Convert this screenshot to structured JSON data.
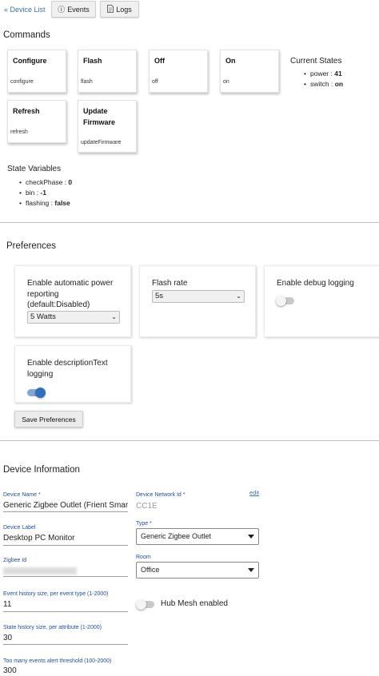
{
  "nav": {
    "back": "« Device List",
    "events": "Events",
    "logs": "Logs",
    "events_icon": "info-circle-icon",
    "logs_icon": "document-icon"
  },
  "commands": {
    "heading": "Commands",
    "items": [
      {
        "title": "Configure",
        "arg": "configure"
      },
      {
        "title": "Flash",
        "arg": "flash"
      },
      {
        "title": "Off",
        "arg": "off"
      },
      {
        "title": "On",
        "arg": "on"
      },
      {
        "title": "Refresh",
        "arg": "refresh"
      },
      {
        "title": "Update Firmware",
        "arg": "updateFirmware"
      }
    ]
  },
  "current_states": {
    "title": "Current States",
    "items": [
      {
        "key": "power",
        "value": "41"
      },
      {
        "key": "switch",
        "value": "on"
      }
    ]
  },
  "state_variables": {
    "title": "State Variables",
    "items": [
      {
        "key": "checkPhase",
        "value": "0"
      },
      {
        "key": "bin",
        "value": "-1"
      },
      {
        "key": "flashing",
        "value": "false"
      }
    ]
  },
  "preferences": {
    "heading": "Preferences",
    "power_reporting": {
      "label": "Enable automatic power reporting (default:Disabled)",
      "value": "5 Watts"
    },
    "flash_rate": {
      "label": "Flash rate",
      "value": "5s"
    },
    "debug_logging": {
      "label": "Enable debug logging",
      "enabled": false
    },
    "description_logging": {
      "label": "Enable descriptionText logging",
      "enabled": true
    },
    "save": "Save Preferences",
    "toggle_on_color": "#2f6fc0"
  },
  "device_info": {
    "heading": "Device Information",
    "device_name": {
      "label": "Device Name *",
      "value": "Generic Zigbee Outlet (Frient Smart"
    },
    "network_id": {
      "label": "Device Network Id *",
      "value": "CC1E",
      "edit": "edit"
    },
    "device_label": {
      "label": "Device Label",
      "value": "Desktop PC Monitor"
    },
    "type": {
      "label": "Type *",
      "value": "Generic Zigbee Outlet"
    },
    "zigbee_id": {
      "label": "Zigbee Id"
    },
    "room": {
      "label": "Room",
      "value": "Office"
    },
    "event_history": {
      "label": "Event history size, per event type (1-2000)",
      "value": "11"
    },
    "hub_mesh": {
      "label": "Hub Mesh enabled",
      "enabled": false
    },
    "state_history": {
      "label": "State history size, per attribute (1-2000)",
      "value": "30"
    },
    "too_many_events": {
      "label": "Too many events alert threshold (100-2000)",
      "value": "300"
    }
  },
  "colors": {
    "link": "#3b6fb6",
    "field_label": "#1f4fa0"
  }
}
